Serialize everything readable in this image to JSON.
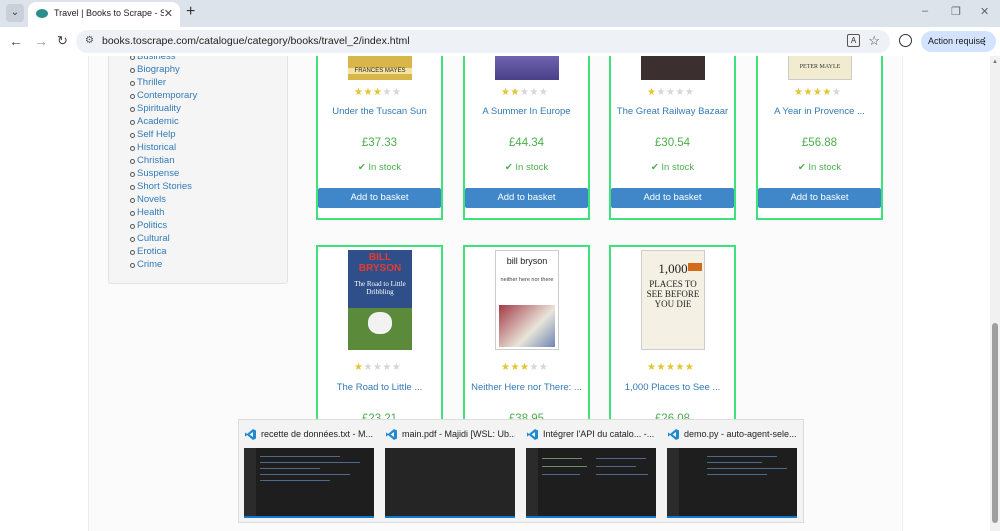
{
  "browser": {
    "tab_title": "Travel | Books to Scrape - Sandbox",
    "tab_close": "✕",
    "new_tab": "+",
    "url": "books.toscrape.com/catalogue/category/books/travel_2/index.html",
    "action_button": "Action requise",
    "window_controls": [
      "–",
      "❐",
      "✕"
    ]
  },
  "sidebar": {
    "categories": [
      "Business",
      "Biography",
      "Thriller",
      "Contemporary",
      "Spirituality",
      "Academic",
      "Self Help",
      "Historical",
      "Christian",
      "Suspense",
      "Short Stories",
      "Novels",
      "Health",
      "Politics",
      "Cultural",
      "Erotica",
      "Crime"
    ]
  },
  "books": [
    {
      "title": "Under the Tuscan Sun",
      "rating": 3,
      "price": "£37.33",
      "stock": "In stock",
      "button": "Add to basket",
      "cover_text": "FRANCES MAYES",
      "cover_color": "#c7a33d"
    },
    {
      "title": "A Summer In Europe",
      "rating": 2,
      "price": "£44.34",
      "stock": "In stock",
      "button": "Add to basket",
      "cover_text": "",
      "cover_color": "#6b5da8"
    },
    {
      "title": "The Great Railway Bazaar",
      "rating": 1,
      "price": "£30.54",
      "stock": "In stock",
      "button": "Add to basket",
      "cover_text": "",
      "cover_color": "#3b2f30"
    },
    {
      "title": "A Year in Provence ...",
      "rating": 4,
      "price": "£56.88",
      "stock": "In stock",
      "button": "Add to basket",
      "cover_text": "PETER MAYLE",
      "cover_color": "#f1ebcf"
    },
    {
      "title": "The Road to Little ...",
      "rating": 1,
      "price": "£23.21",
      "cover_author": "BILL BRYSON",
      "cover_text": "The Road to Little Dribbling",
      "cover_color": "#2e4f8a"
    },
    {
      "title": "Neither Here nor There: ...",
      "rating": 3,
      "price": "£38.95",
      "cover_author": "bill bryson",
      "cover_text": "neither here nor there",
      "cover_color": "#ffffff"
    },
    {
      "title": "1,000 Places to See ...",
      "rating": 5,
      "price": "£26.08",
      "cover_author": "1,000",
      "cover_text": "PLACES TO SEE BEFORE YOU DIE",
      "cover_color": "#f4f1e4"
    }
  ],
  "taskbar_previews": [
    {
      "label": "recette de données.txt - M..."
    },
    {
      "label": "main.pdf - Majidi [WSL: Ub..."
    },
    {
      "label": "Intégrer l'API du catalo... -..."
    },
    {
      "label": "demo.py - auto-agent-sele..."
    }
  ]
}
